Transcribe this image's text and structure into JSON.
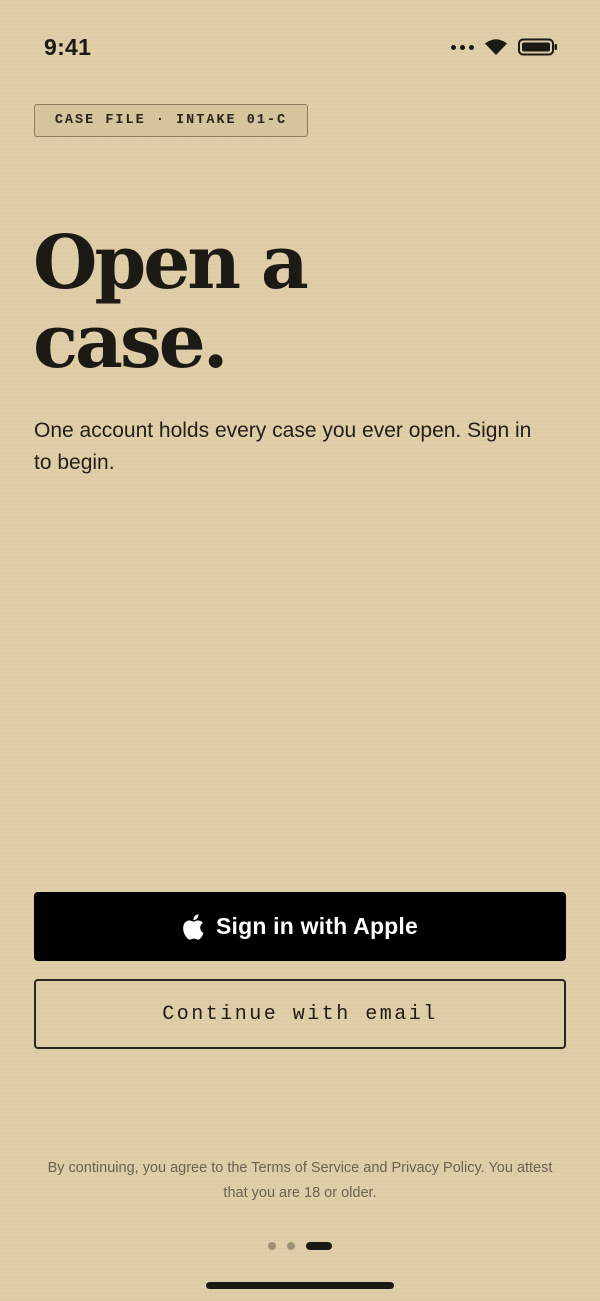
{
  "status_bar": {
    "time": "9:41",
    "icons": [
      "signal-dots-icon",
      "wifi-icon",
      "battery-icon"
    ]
  },
  "case_tag": {
    "label": "CASE FILE · INTAKE 01-C"
  },
  "headline": {
    "line1": "Open a",
    "line2": "case."
  },
  "subtext": "One account holds every case you ever open. Sign in to begin.",
  "buttons": {
    "apple_label": "Sign in with Apple",
    "apple_icon": "apple-logo-icon",
    "email_label": "Continue with email"
  },
  "legal": "By continuing, you agree to the Terms of Service and Privacy Policy. You attest that you are 18 or older.",
  "pagination": {
    "total": 3,
    "active_index": 2
  },
  "colors": {
    "background": "#dfcea8",
    "ink": "#1f1c17",
    "apple_button": "#000000",
    "muted_text": "#6b6250"
  }
}
